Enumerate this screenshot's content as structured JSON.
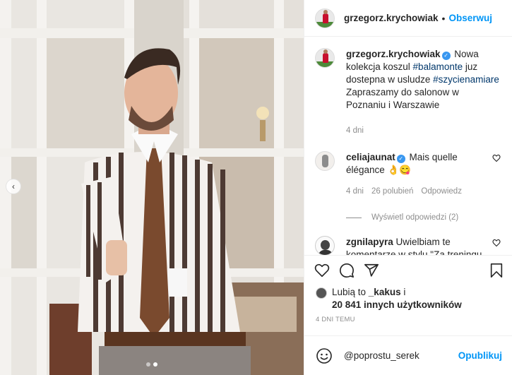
{
  "header": {
    "username": "grzegorz.krychowiak",
    "separator": "•",
    "follow_label": "Obserwuj"
  },
  "caption": {
    "username": "grzegorz.krychowiak",
    "text_1": " Nowa kolekcja koszul ",
    "tag_1": "#balamonte",
    "text_2": " juz dostepna w usludze ",
    "tag_2": "#szycienamiare",
    "text_3": " Zapraszamy do salonow w Poznaniu i Warszawie",
    "time": "4 dni"
  },
  "comments": [
    {
      "username": "celiajaunat",
      "text": " Mais quelle élégance 👌😋",
      "time": "4 dni",
      "likes": "26 polubień",
      "reply_label": "Odpowiedz",
      "view_replies": "Wyświetl odpowiedzi (2)"
    },
    {
      "username": "zgnilapyra",
      "text": " Uwielbiam te komentarze w stylu \"Za treningu się weź\". Wam też obcy ludzie na ulicy mówia co macie robić i"
    }
  ],
  "likes": {
    "prefix": "Lubią to ",
    "user": "_kakus",
    "mid": " i",
    "count": "20 841 innych użytkowników"
  },
  "posted_ago": "4 DNI TEMU",
  "add_comment": {
    "value": "@poprostu_serek",
    "post_label": "Opublikuj"
  },
  "icons": {
    "like": "heart-icon",
    "comment": "comment-icon",
    "share": "share-icon",
    "save": "bookmark-icon",
    "emoji": "emoji-icon"
  },
  "colors": {
    "accent": "#0095f6",
    "hashtag": "#00376b",
    "muted": "#8e8e8e",
    "verified": "#3897f0"
  }
}
